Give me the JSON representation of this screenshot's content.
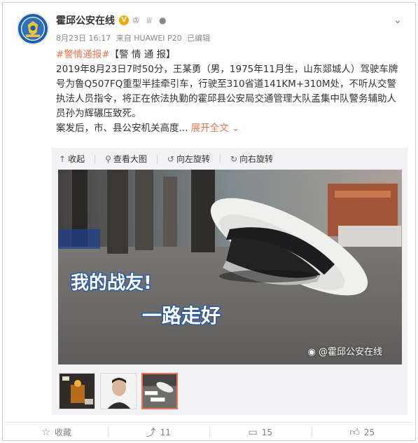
{
  "post": {
    "author": "霍邱公安在线",
    "meta": {
      "date_time": "8月23日 16:17",
      "source": "来自 HUAWEI P20",
      "edited": "已编辑"
    },
    "text": {
      "tag": "#警情通报#",
      "heading": "【警 情 通 报】",
      "body": "2019年8月23日7时50分，王某勇（男，1975年11月生，山东郯城人）驾驶车牌号为鲁Q507FQ重型半挂牵引车，行驶至310省道141KM+310M处，不听从交警执法人员指令，将正在依法执勤的霍邱县公安局交通管理大队孟集中队警务辅助人员孙为辉碾压致死。",
      "second_line": "案发后，市、县公安机关高度",
      "ellipsis": "...",
      "expand": "展开全文",
      "expand_icon": "chevron-down-icon"
    },
    "toolbar": {
      "collapse": "收起",
      "view_large": "查看大图",
      "rotate_left": "向左旋转",
      "rotate_right": "向右旋转"
    },
    "image": {
      "caption_line1": "我的战友!",
      "caption_line2": "一路走好",
      "watermark": "@霍邱公安在线"
    },
    "thumbnails": [
      "memorial-poster",
      "portrait",
      "cap-on-road"
    ],
    "actions": {
      "favorite": "收藏",
      "repost": "11",
      "comment": "15",
      "like": "25"
    },
    "colors": {
      "accent": "#eb7350",
      "verified_badge": "#f7a600",
      "toolbar_bg": "#f2f2f5",
      "avatar_blue": "#1f5fa8"
    }
  }
}
